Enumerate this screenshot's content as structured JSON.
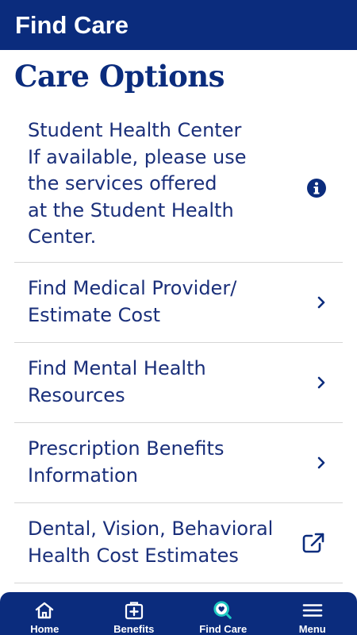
{
  "header": {
    "title": "Find Care"
  },
  "section": {
    "title": "Care Options"
  },
  "items": [
    {
      "label": "Student Health Center\nIf available, please use\nthe services offered\nat the Student Health\nCenter.",
      "icon": "info-icon"
    },
    {
      "label": "Find Medical Provider/\nEstimate Cost",
      "icon": "chevron-right-icon"
    },
    {
      "label": "Find Mental Health\nResources",
      "icon": "chevron-right-icon"
    },
    {
      "label": "Prescription Benefits\nInformation",
      "icon": "chevron-right-icon"
    },
    {
      "label": "Dental, Vision, Behavioral\nHealth Cost Estimates",
      "icon": "external-link-icon"
    }
  ],
  "nav": [
    {
      "label": "Home",
      "icon": "home-icon"
    },
    {
      "label": "Benefits",
      "icon": "medical-kit-icon"
    },
    {
      "label": "Find Care",
      "icon": "search-heart-icon"
    },
    {
      "label": "Menu",
      "icon": "hamburger-menu-icon"
    }
  ],
  "colors": {
    "primary": "#0b2c7d",
    "text": "#1a2f7a",
    "accent": "#1ec9c3",
    "divider": "#d6d6d6"
  }
}
